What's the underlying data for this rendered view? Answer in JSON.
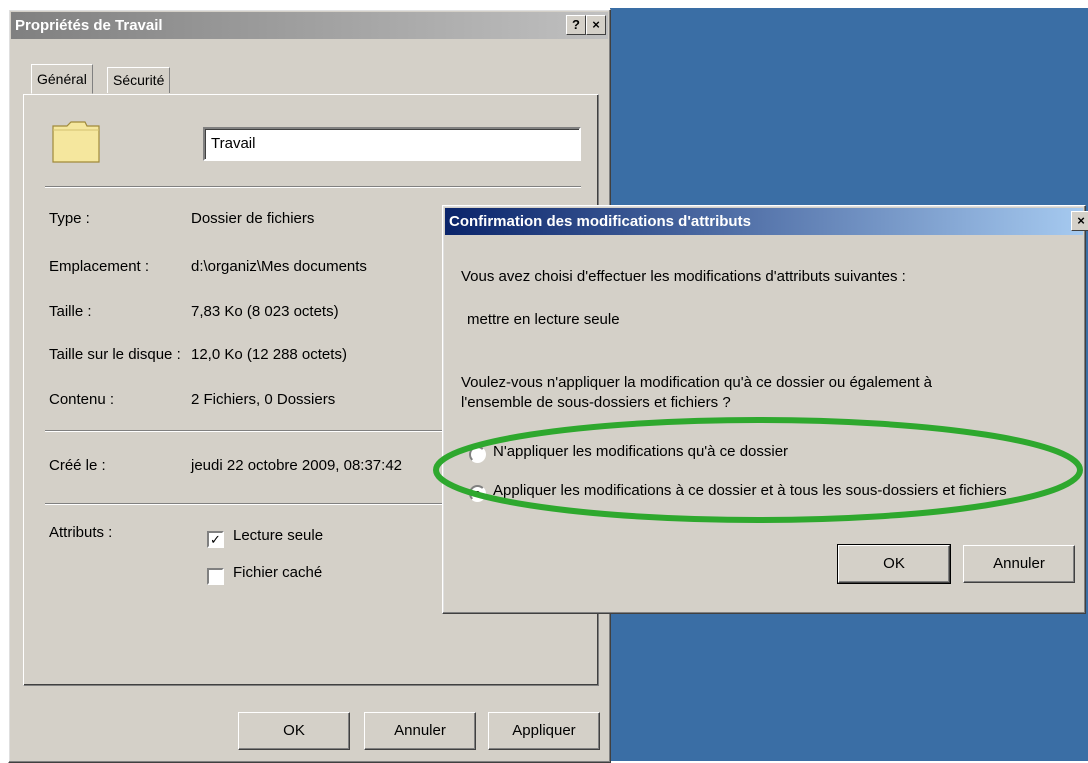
{
  "properties_dialog": {
    "title": "Propriétés de Travail",
    "help_btn": "?",
    "close_btn": "×",
    "tabs": [
      "Général",
      "Sécurité"
    ],
    "folder_name": "Travail",
    "rows": [
      {
        "label": "Type :",
        "value": "Dossier de fichiers"
      },
      {
        "label": "Emplacement :",
        "value": "d:\\organiz\\Mes documents"
      },
      {
        "label": "Taille :",
        "value": "7,83 Ko (8 023 octets)"
      },
      {
        "label": "Taille sur le disque :",
        "value": "12,0 Ko (12 288 octets)"
      },
      {
        "label": "Contenu :",
        "value": "2 Fichiers, 0 Dossiers"
      }
    ],
    "created": {
      "label": "Créé le :",
      "value": "jeudi 22 octobre 2009, 08:37:42"
    },
    "attributes_label": "Attributs :",
    "attributes": [
      {
        "label": "Lecture seule",
        "checked": true,
        "mark": "✓"
      },
      {
        "label": "Fichier caché",
        "checked": false,
        "mark": ""
      }
    ],
    "buttons": {
      "ok": "OK",
      "cancel": "Annuler",
      "apply": "Appliquer"
    }
  },
  "confirm_dialog": {
    "title": "Confirmation des modifications d'attributs",
    "close_btn": "×",
    "intro": "Vous avez choisi d'effectuer les modifications d'attributs suivantes :",
    "change": "mettre en lecture seule",
    "question_line1": "Voulez-vous n'appliquer la modification qu'à ce dossier ou également à",
    "question_line2": "l'ensemble de sous-dossiers et fichiers ?",
    "options": [
      {
        "label": "N'appliquer les modifications qu'à ce dossier",
        "selected": false
      },
      {
        "label": "Appliquer les modifications à ce dossier et à tous les sous-dossiers et fichiers",
        "selected": true
      }
    ],
    "buttons": {
      "ok": "OK",
      "cancel": "Annuler"
    }
  },
  "colors": {
    "desktop": "#3a6ea5",
    "dialog_face": "#d4d0c8",
    "active_title": "#0a246a",
    "highlight": "#2ea82e"
  }
}
